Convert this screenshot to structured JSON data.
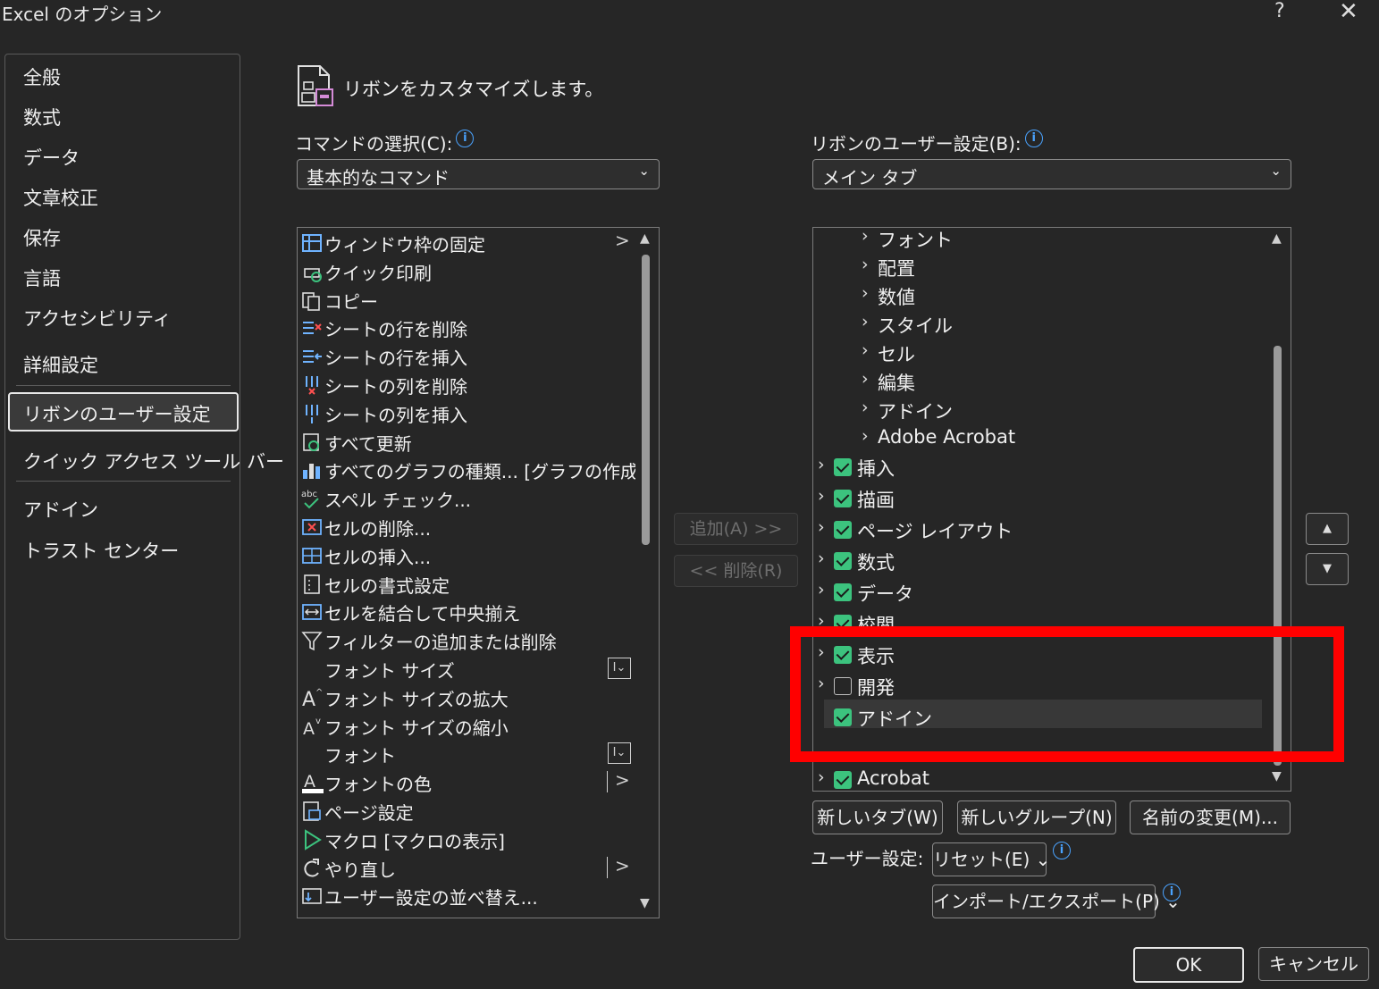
{
  "window": {
    "title": "Excel のオプション",
    "help": "?",
    "close": "✕"
  },
  "sidebar": {
    "items": [
      {
        "label": "全般"
      },
      {
        "label": "数式"
      },
      {
        "label": "データ"
      },
      {
        "label": "文章校正"
      },
      {
        "label": "保存"
      },
      {
        "label": "言語"
      },
      {
        "label": "アクセシビリティ"
      },
      {
        "label": "詳細設定"
      },
      {
        "label": "リボンのユーザー設定"
      },
      {
        "label": "クイック アクセス ツール バー"
      },
      {
        "label": "アドイン"
      },
      {
        "label": "トラスト センター"
      }
    ],
    "selected": "リボンのユーザー設定"
  },
  "header": {
    "heading": "リボンをカスタマイズします。"
  },
  "commands": {
    "label": "コマンドの選択(C):",
    "dropdown_value": "基本的なコマンド",
    "items": [
      {
        "label": "ウィンドウ枠の固定",
        "icon": "freeze-panes-icon",
        "arrow": ">"
      },
      {
        "label": "クイック印刷",
        "icon": "quick-print-icon"
      },
      {
        "label": "コピー",
        "icon": "copy-icon"
      },
      {
        "label": "シートの行を削除",
        "icon": "delete-row-icon"
      },
      {
        "label": "シートの行を挿入",
        "icon": "insert-row-icon"
      },
      {
        "label": "シートの列を削除",
        "icon": "delete-column-icon"
      },
      {
        "label": "シートの列を挿入",
        "icon": "insert-column-icon"
      },
      {
        "label": "すべて更新",
        "icon": "refresh-all-icon"
      },
      {
        "label": "すべてのグラフの種類... [グラフの作成]",
        "icon": "chart-icon"
      },
      {
        "label": "スペル チェック...",
        "icon": "spell-check-icon"
      },
      {
        "label": "セルの削除...",
        "icon": "delete-cells-icon"
      },
      {
        "label": "セルの挿入...",
        "icon": "insert-cells-icon"
      },
      {
        "label": "セルの書式設定",
        "icon": "format-cells-icon"
      },
      {
        "label": "セルを結合して中央揃え",
        "icon": "merge-center-icon"
      },
      {
        "label": "フィルターの追加または削除",
        "icon": "filter-icon"
      },
      {
        "label": "フォント サイズ",
        "icon": "",
        "combo": "I⌄"
      },
      {
        "label": "フォント サイズの拡大",
        "icon": "font-grow-icon"
      },
      {
        "label": "フォント サイズの縮小",
        "icon": "font-shrink-icon"
      },
      {
        "label": "フォント",
        "icon": "",
        "combo": "I⌄"
      },
      {
        "label": "フォントの色",
        "icon": "font-color-icon",
        "split": ">"
      },
      {
        "label": "ページ設定",
        "icon": "page-setup-icon"
      },
      {
        "label": "マクロ [マクロの表示]",
        "icon": "macro-icon"
      },
      {
        "label": "やり直し",
        "icon": "redo-icon",
        "split": ">"
      },
      {
        "label": "ユーザー設定の並べ替え...",
        "icon": "custom-sort-icon"
      }
    ]
  },
  "middle": {
    "add": "追加(A) >>",
    "remove": "<< 削除(R)"
  },
  "ribbon": {
    "label": "リボンのユーザー設定(B):",
    "dropdown_value": "メイン タブ",
    "tree": [
      {
        "label": "フォント",
        "level": 2
      },
      {
        "label": "配置",
        "level": 2
      },
      {
        "label": "数値",
        "level": 2
      },
      {
        "label": "スタイル",
        "level": 2
      },
      {
        "label": "セル",
        "level": 2
      },
      {
        "label": "編集",
        "level": 2
      },
      {
        "label": "アドイン",
        "level": 2
      },
      {
        "label": "Adobe Acrobat",
        "level": 2
      },
      {
        "label": "挿入",
        "level": 1,
        "checked": true
      },
      {
        "label": "描画",
        "level": 1,
        "checked": true
      },
      {
        "label": "ページ レイアウト",
        "level": 1,
        "checked": true
      },
      {
        "label": "数式",
        "level": 1,
        "checked": true
      },
      {
        "label": "データ",
        "level": 1,
        "checked": true
      },
      {
        "label": "校閲",
        "level": 1,
        "checked": true
      },
      {
        "label": "表示",
        "level": 1,
        "checked": true
      },
      {
        "label": "開発",
        "level": 1,
        "checked": false
      },
      {
        "label": "アドイン",
        "level": 1,
        "checked": true,
        "no_chevron": true
      },
      {
        "label": "Acrobat",
        "level": 1,
        "checked": true
      }
    ],
    "new_tab": "新しいタブ(W)",
    "new_group": "新しいグループ(N)",
    "rename": "名前の変更(M)...",
    "user_settings_label": "ユーザー設定:",
    "reset": "リセット(E) ⌄",
    "import_export": "インポート/エクスポート(P) ⌄"
  },
  "footer": {
    "ok": "OK",
    "cancel": "キャンセル"
  },
  "colors": {
    "accent_check": "#3cc37e",
    "highlight": "#ff0000",
    "info": "#4aa3ff"
  }
}
